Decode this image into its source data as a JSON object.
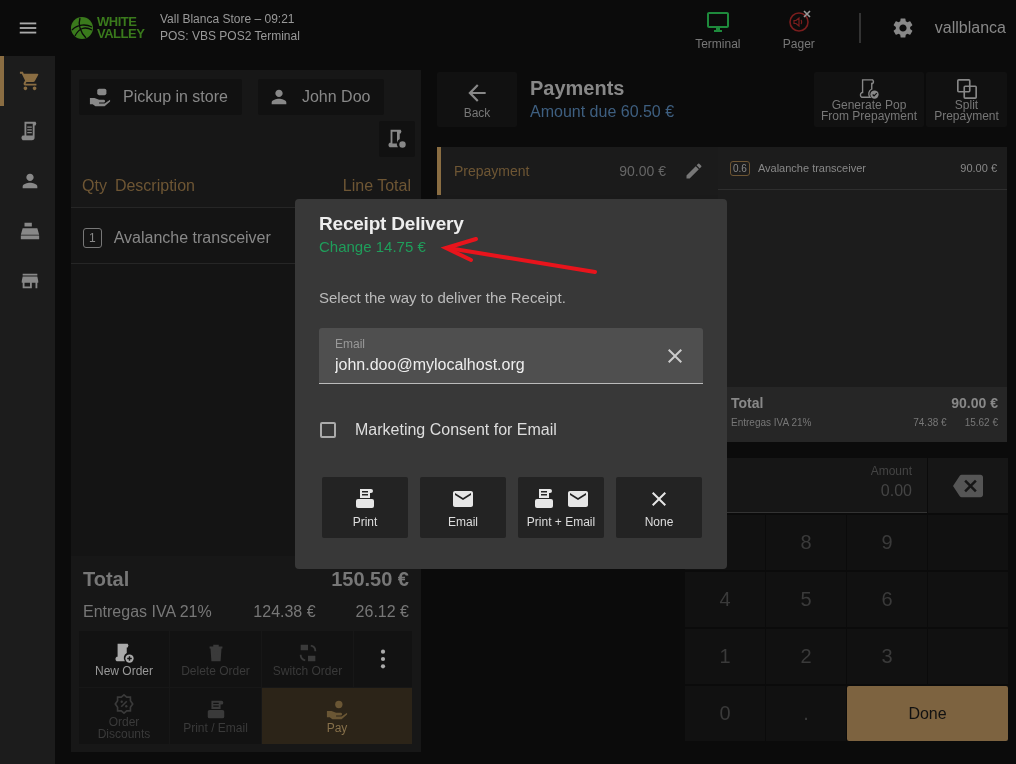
{
  "topbar": {
    "logo": "WHITE\nVALLEY",
    "store": "Vall Blanca Store – 09:21",
    "terminal": "POS: VBS POS2 Terminal",
    "devices": [
      {
        "kind": "terminal",
        "label": "Terminal",
        "connected": true
      },
      {
        "kind": "pager",
        "label": "Pager",
        "connected": false
      }
    ],
    "user": "vallblanca"
  },
  "sidebar": {
    "items": [
      {
        "kind": "cart",
        "selected": true
      },
      {
        "kind": "receipt",
        "selected": false
      },
      {
        "kind": "person",
        "selected": false
      },
      {
        "kind": "register",
        "selected": false
      },
      {
        "kind": "store",
        "selected": false
      }
    ]
  },
  "order": {
    "buttons": [
      {
        "kind": "pickup",
        "label": "Pickup in store"
      },
      {
        "kind": "customer",
        "label": "John Doo"
      }
    ],
    "columns": [
      "Qty",
      "Description",
      "Line Total"
    ],
    "lines": [
      {
        "qty": "1",
        "description": "Avalanche transceiver"
      }
    ],
    "total_label": "Total",
    "total": "150.50 €",
    "tax": {
      "label": "Entregas IVA 21%",
      "base": "124.38 €",
      "amount": "26.12 €"
    },
    "actions": [
      {
        "kind": "new",
        "label": "New Order",
        "disabled": false
      },
      {
        "kind": "delete",
        "label": "Delete Order",
        "disabled": true
      },
      {
        "kind": "switch",
        "label": "Switch Order",
        "disabled": true
      },
      {
        "kind": "more",
        "disabled": false
      },
      {
        "kind": "discounts",
        "label": "Order\nDiscounts",
        "disabled": true
      },
      {
        "kind": "print",
        "label": "Print / Email",
        "disabled": true
      },
      {
        "kind": "pay",
        "label": "Pay",
        "disabled": true
      }
    ]
  },
  "payments": {
    "back": "Back",
    "title": "Payments",
    "amount_due_label": "Amount due",
    "amount_due": "60.50 €",
    "tools": [
      {
        "kind": "generate",
        "label": "Generate Pop\nFrom Prepayment"
      },
      {
        "kind": "split",
        "label": "Split\nPrepayment"
      }
    ],
    "methods": [
      {
        "name": "Prepayment",
        "amount": "90.00 €",
        "selected": true
      }
    ],
    "items": [
      {
        "qty": "0.6",
        "description": "Avalanche transceiver",
        "amount": "90.00 €"
      }
    ],
    "total_label": "Total",
    "total": "90.00 €",
    "tax": {
      "label": "Entregas IVA 21%",
      "base": "74.38 €",
      "amount": "15.62 €"
    }
  },
  "keypad": {
    "amount_label": "Amount",
    "amount": "0.00",
    "keys": [
      {
        "kind": "blank"
      },
      {
        "kind": "digit",
        "label": "8"
      },
      {
        "kind": "digit",
        "label": "9"
      },
      {
        "kind": "blank"
      },
      {
        "kind": "digit",
        "label": "4"
      },
      {
        "kind": "digit",
        "label": "5"
      },
      {
        "kind": "digit",
        "label": "6"
      },
      {
        "kind": "blank"
      },
      {
        "kind": "digit",
        "label": "1"
      },
      {
        "kind": "digit",
        "label": "2"
      },
      {
        "kind": "digit",
        "label": "3"
      },
      {
        "kind": "blank"
      },
      {
        "kind": "digit",
        "label": "0"
      },
      {
        "kind": "digit",
        "label": "."
      }
    ],
    "done": "Done"
  },
  "dialog": {
    "title": "Receipt Delivery",
    "change": "Change 14.75 €",
    "message": "Select the way to deliver the Receipt.",
    "email": {
      "label": "Email",
      "value": "john.doo@mylocalhost.org"
    },
    "consent": {
      "label": "Marketing Consent for Email",
      "checked": false
    },
    "options": [
      {
        "kind": "print",
        "label": "Print"
      },
      {
        "kind": "email",
        "label": "Email"
      },
      {
        "kind": "print_email",
        "label": "Print + Email"
      },
      {
        "kind": "none",
        "label": "None"
      }
    ]
  }
}
